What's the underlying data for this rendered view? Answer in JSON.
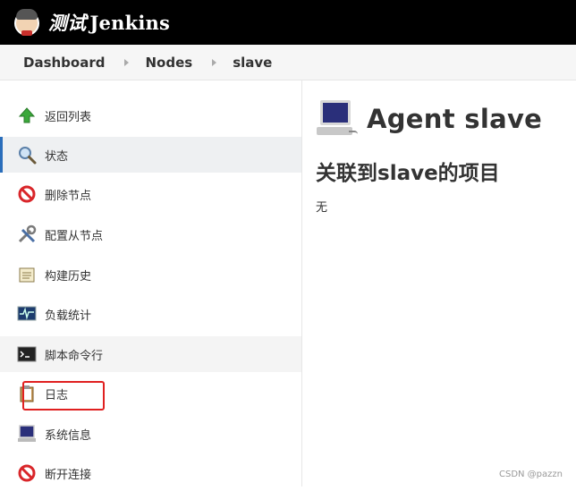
{
  "header": {
    "brand_cn": "测试",
    "brand_en": "Jenkins",
    "logo_icon": "jenkins-butler-icon"
  },
  "breadcrumb": [
    "Dashboard",
    "Nodes",
    "slave"
  ],
  "sidebar": {
    "items": [
      {
        "label": "返回列表",
        "icon": "up-arrow-icon"
      },
      {
        "label": "状态",
        "icon": "search-icon"
      },
      {
        "label": "删除节点",
        "icon": "no-entry-icon"
      },
      {
        "label": "配置从节点",
        "icon": "tools-icon"
      },
      {
        "label": "构建历史",
        "icon": "notepad-icon"
      },
      {
        "label": "负载统计",
        "icon": "monitor-graph-icon"
      },
      {
        "label": "脚本命令行",
        "icon": "terminal-icon"
      },
      {
        "label": "日志",
        "icon": "clipboard-icon"
      },
      {
        "label": "系统信息",
        "icon": "computer-icon"
      },
      {
        "label": "断开连接",
        "icon": "no-entry-icon"
      }
    ],
    "active_index": 1,
    "highlighted_index": 7
  },
  "main": {
    "title": "Agent slave",
    "subtitle": "关联到slave的项目",
    "empty_text": "无"
  },
  "watermark": "CSDN @pazzn",
  "colors": {
    "header_bg": "#000000",
    "active_border": "#2a6ebb",
    "annotation_red": "#e02020"
  }
}
